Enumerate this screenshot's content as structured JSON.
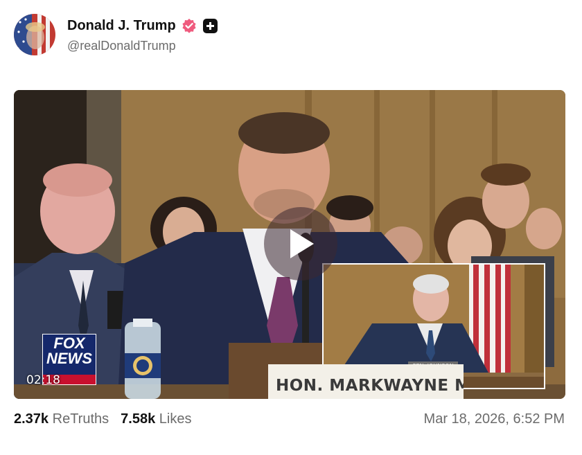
{
  "author": {
    "display_name": "Donald J. Trump",
    "handle": "@realDonaldTrump",
    "verified_icon": "verified-badge-icon",
    "plus_icon": "plus-badge-icon"
  },
  "video": {
    "play_icon": "play-icon",
    "timestamp": "02:18",
    "network_logo": "FOX NEWS channel",
    "nameplate_text": "HON. MARKWAYNE MULLIN",
    "inset_nameplate": "SEN. JOHNSON"
  },
  "stats": {
    "retruths_count": "2.37k",
    "retruths_label": "ReTruths",
    "likes_count": "7.58k",
    "likes_label": "Likes"
  },
  "post_date": "Mar 18, 2026, 6:52 PM",
  "colors": {
    "verified": "#ef5b7e",
    "fox_blue": "#15286b",
    "fox_red": "#c8102e"
  }
}
